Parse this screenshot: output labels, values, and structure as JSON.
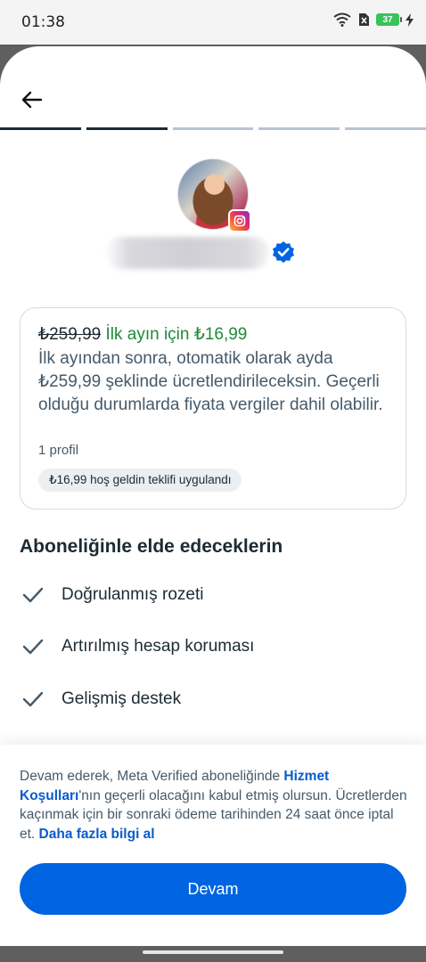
{
  "status_bar": {
    "time": "01:38",
    "battery": "37"
  },
  "progress": {
    "total_steps": 5,
    "completed_steps": 2,
    "active_color": "#1c2b33",
    "inactive_color": "#b8c4d0"
  },
  "profile": {
    "name_hidden": true,
    "platform_icon": "instagram-icon",
    "verified_icon": "verified-check-icon"
  },
  "offer": {
    "old_price": "₺259,99",
    "promo_text": "İlk ayın için ₺16,99",
    "description": "İlk ayından sonra, otomatik olarak ayda ₺259,99 şeklinde ücretlendirileceksin. Geçerli olduğu durumlarda fiyata vergiler dahil olabilir.",
    "profile_count": "1 profil",
    "welcome_chip": "₺16,99 hoş geldin teklifi uygulandı"
  },
  "benefits": {
    "title": "Aboneliğinle elde edeceklerin",
    "items": [
      {
        "label": "Doğrulanmış rozeti"
      },
      {
        "label": "Artırılmış hesap koruması"
      },
      {
        "label": "Gelişmiş destek"
      }
    ]
  },
  "footer": {
    "terms_prefix": "Devam ederek, Meta Verified aboneliğinde ",
    "terms_link": "Hizmet Koşulları",
    "terms_middle": "'nın geçerli olacağını kabul etmiş olursun. Ücretlerden kaçınmak için bir sonraki ödeme tarihinden 24 saat önce iptal et. ",
    "learn_more_link": "Daha fazla bilgi al",
    "continue_label": "Devam"
  },
  "colors": {
    "primary": "#0064e0",
    "promo_green": "#1f8a3a",
    "link": "#0a5bcc"
  }
}
